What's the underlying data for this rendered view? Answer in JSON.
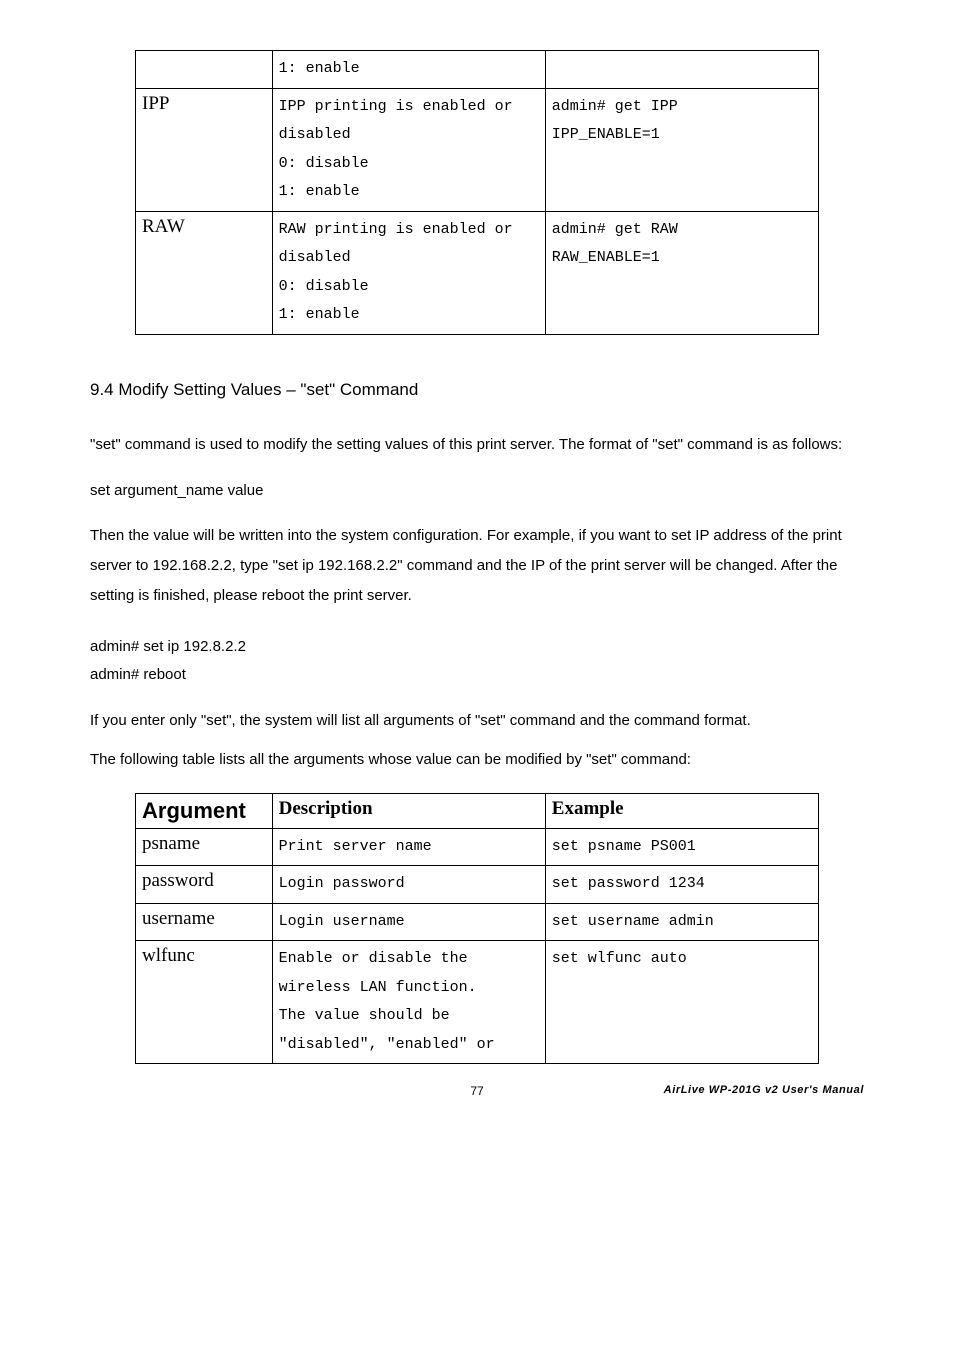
{
  "table1": {
    "rows": [
      {
        "arg": "",
        "desc_lines": [
          "1: enable"
        ],
        "example_lines": []
      },
      {
        "arg": "IPP",
        "desc_lines": [
          "IPP printing is enabled or",
          "disabled",
          "0: disable",
          "1: enable"
        ],
        "example_lines": [
          "admin# get IPP",
          "IPP_ENABLE=1"
        ]
      },
      {
        "arg": "RAW",
        "desc_lines": [
          "RAW printing is enabled or",
          "disabled",
          "0: disable",
          "1: enable"
        ],
        "example_lines": [
          "admin# get RAW",
          "RAW_ENABLE=1"
        ]
      }
    ]
  },
  "section_heading": "9.4 Modify Setting Values – \"set\" Command",
  "paragraphs": {
    "p1": "\"set\" command is used to modify the setting values of this print server. The format of \"set\" command is as follows:",
    "p2": "set argument_name value",
    "p3": "Then the value will be written into the system configuration. For example, if you want to set IP address of the print server to 192.168.2.2, type \"set ip 192.168.2.2\" command and the IP of the print server will be changed. After the setting is finished, please reboot the print server.",
    "p4_lines": [
      "admin# set ip 192.8.2.2",
      "admin# reboot"
    ],
    "p5": "If you enter only \"set\", the system will list all arguments of \"set\" command and the command format.",
    "p6": "The following table lists all the arguments whose value can be modified by \"set\" command:"
  },
  "table2": {
    "headers": {
      "arg": "Argument",
      "desc": "Description",
      "ex": "Example"
    },
    "rows": [
      {
        "arg": "psname",
        "desc_lines": [
          "Print server name"
        ],
        "example_lines": [
          "set psname PS001"
        ]
      },
      {
        "arg": "password",
        "desc_lines": [
          "Login password"
        ],
        "example_lines": [
          "set password 1234"
        ]
      },
      {
        "arg": "username",
        "desc_lines": [
          "Login username"
        ],
        "example_lines": [
          "set username admin"
        ]
      },
      {
        "arg": "wlfunc",
        "desc_lines": [
          "Enable or disable the",
          "wireless LAN function.",
          "The value should be",
          "\"disabled\", \"enabled\" or"
        ],
        "example_lines": [
          "set wlfunc auto"
        ]
      }
    ]
  },
  "footer": {
    "page": "77",
    "manual": "AirLive WP-201G v2 User's Manual"
  }
}
